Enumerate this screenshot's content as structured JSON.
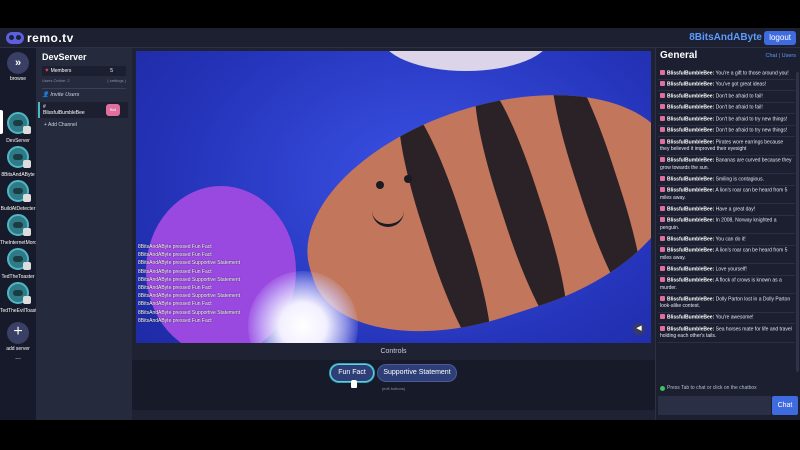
{
  "header": {
    "logo_text": "remo.tv",
    "username": "8BitsAndAByte",
    "logout_label": "logout"
  },
  "rail": {
    "browse_label": "browse",
    "servers": [
      {
        "label": "DevServer"
      },
      {
        "label": "8BitsAndAByte"
      },
      {
        "label": "BuildAtDetecter"
      },
      {
        "label": "TheInternetMoro"
      },
      {
        "label": "TedTheToaster"
      },
      {
        "label": "TedTheEvilToast"
      }
    ],
    "add_label": "add server",
    "more": "..."
  },
  "channels": {
    "server_name": "DevServer",
    "members_label": "Members",
    "members_count": "5",
    "sub_left": "Users Online: 2",
    "sub_right": "( settings )",
    "invite_label": "Invite Users",
    "channel_hash": "#",
    "channel_name": "BlissfulBumbleBee",
    "channel_badge": "Bot",
    "add_channel": "+ Add Channel"
  },
  "video": {
    "log": [
      "8BitsAndAByte pressed Fun Fact",
      "8BitsAndAByte pressed Fun Fact",
      "8BitsAndAByte pressed Supportive Statement",
      "8BitsAndAByte pressed Fun Fact",
      "8BitsAndAByte pressed Supportive Statement",
      "8BitsAndAByte pressed Fun Fact",
      "8BitsAndAByte pressed Supportive Statement",
      "8BitsAndAByte pressed Fun Fact",
      "8BitsAndAByte pressed Supportive Statement",
      "8BitsAndAByte pressed Fun Fact"
    ]
  },
  "controls": {
    "title": "Controls",
    "buttons": [
      "Fun Fact",
      "Supportive Statement"
    ],
    "edit_label": "(edit buttons)"
  },
  "chat": {
    "title": "General",
    "tab_chat": "Chat",
    "tab_sep": " | ",
    "tab_users": "Users",
    "messages": [
      {
        "user": "BlissfulBumbleBee:",
        "text": "You're a gift to those around you!"
      },
      {
        "user": "BlissfulBumbleBee:",
        "text": "You've got great ideas!"
      },
      {
        "user": "BlissfulBumbleBee:",
        "text": "Don't be afraid to fail!"
      },
      {
        "user": "BlissfulBumbleBee:",
        "text": "Don't be afraid to fail!"
      },
      {
        "user": "BlissfulBumbleBee:",
        "text": "Don't be afraid to try new things!"
      },
      {
        "user": "BlissfulBumbleBee:",
        "text": "Don't be afraid to try new things!"
      },
      {
        "user": "BlissfulBumbleBee:",
        "text": "Pirates wore earrings because they believed it improved their eyesight"
      },
      {
        "user": "BlissfulBumbleBee:",
        "text": "Bananas are curved because they grow towards the sun."
      },
      {
        "user": "BlissfulBumbleBee:",
        "text": "Smiling is contagious."
      },
      {
        "user": "BlissfulBumbleBee:",
        "text": "A lion's roar can be heard from 5 miles away."
      },
      {
        "user": "BlissfulBumbleBee:",
        "text": "Have a great day!"
      },
      {
        "user": "BlissfulBumbleBee:",
        "text": "In 2008, Norway knighted a penguin."
      },
      {
        "user": "BlissfulBumbleBee:",
        "text": "You can do it!"
      },
      {
        "user": "BlissfulBumbleBee:",
        "text": "A lion's roar can be heard from 5 miles away."
      },
      {
        "user": "BlissfulBumbleBee:",
        "text": "Love yourself!"
      },
      {
        "user": "BlissfulBumbleBee:",
        "text": "A flock of crows is known as a murder."
      },
      {
        "user": "BlissfulBumbleBee:",
        "text": "Dolly Parton lost in a Dolly Parton look-alike contest."
      },
      {
        "user": "BlissfulBumbleBee:",
        "text": "You're awesome!"
      },
      {
        "user": "BlissfulBumbleBee:",
        "text": "Sea horses mate for life and travel holding each other's tails."
      }
    ],
    "hint": "Press Tab to chat or click on the chatbox",
    "send_label": "Chat"
  }
}
